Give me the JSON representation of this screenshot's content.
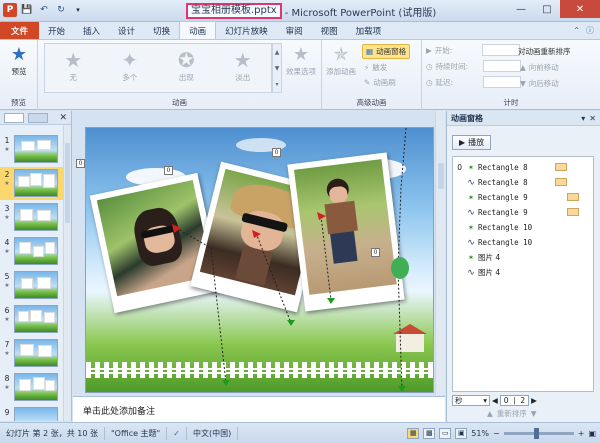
{
  "window": {
    "file_name": "宝宝相册模板.pptx",
    "title_suffix": "- Microsoft PowerPoint (试用版)",
    "app_badge": "P"
  },
  "tabs": [
    {
      "label": "文件"
    },
    {
      "label": "开始"
    },
    {
      "label": "插入"
    },
    {
      "label": "设计"
    },
    {
      "label": "切换"
    },
    {
      "label": "动画"
    },
    {
      "label": "幻灯片放映"
    },
    {
      "label": "审阅"
    },
    {
      "label": "视图"
    },
    {
      "label": "加载项"
    }
  ],
  "ribbon": {
    "preview_label": "预览",
    "preview_group": "预览",
    "effects": [
      {
        "label": "无"
      },
      {
        "label": "多个"
      },
      {
        "label": "出现"
      },
      {
        "label": "淡出"
      }
    ],
    "effect_options_label": "效果选项",
    "animation_group": "动画",
    "add_animation_label": "添加动画",
    "animation_pane_label": "动画窗格",
    "trigger_label": "触发",
    "animation_painter_label": "动画刷",
    "advanced_group": "高级动画",
    "start_label": "开始:",
    "duration_label": "持续时间:",
    "delay_label": "延迟:",
    "timing_group": "计时",
    "reorder_title": "对动画重新排序",
    "move_earlier": "向前移动",
    "move_later": "向后移动"
  },
  "slides": [
    {
      "num": "1"
    },
    {
      "num": "2"
    },
    {
      "num": "3"
    },
    {
      "num": "4"
    },
    {
      "num": "5"
    },
    {
      "num": "6"
    },
    {
      "num": "7"
    },
    {
      "num": "8"
    },
    {
      "num": "9"
    }
  ],
  "slide_tags": [
    "0",
    "0",
    "0",
    "0"
  ],
  "notes_placeholder": "单击此处添加备注",
  "anim_pane": {
    "title": "动画窗格",
    "play_label": "播放",
    "items": [
      {
        "num": "0",
        "name": "Rectangle 8",
        "icon": "star-effect-icon"
      },
      {
        "num": "",
        "name": "Rectangle 8",
        "icon": "motion-path-icon"
      },
      {
        "num": "",
        "name": "Rectangle 9",
        "icon": "star-effect-icon"
      },
      {
        "num": "",
        "name": "Rectangle 9",
        "icon": "motion-path-icon"
      },
      {
        "num": "",
        "name": "Rectangle 10",
        "icon": "star-effect-icon"
      },
      {
        "num": "",
        "name": "Rectangle 10",
        "icon": "motion-path-icon"
      },
      {
        "num": "",
        "name": "图片 4",
        "icon": "star-effect-icon"
      },
      {
        "num": "",
        "name": "图片 4",
        "icon": "motion-path-icon"
      }
    ],
    "seconds_label": "秒",
    "zoom_values": [
      "0",
      "2"
    ],
    "reorder_label": "重新排序"
  },
  "status": {
    "slide_info": "幻灯片 第 2 张，共 10 张",
    "theme": "\"Office 主题\"",
    "language": "中文(中国)",
    "zoom": "51%"
  }
}
